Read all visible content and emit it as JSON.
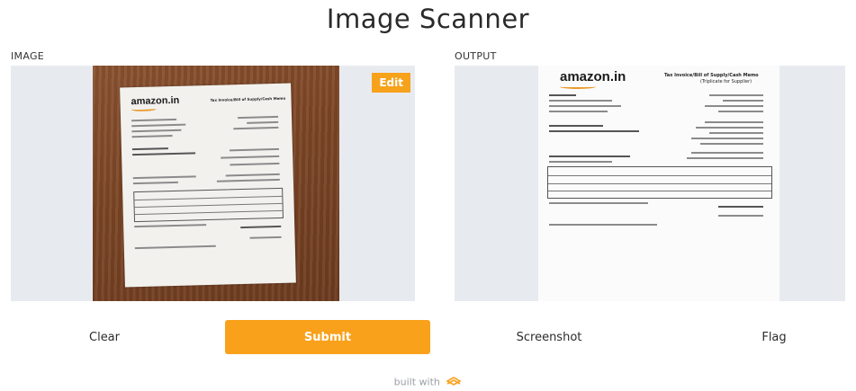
{
  "app": {
    "title": "Image Scanner"
  },
  "input": {
    "label": "IMAGE",
    "edit_label": "Edit"
  },
  "output": {
    "label": "OUTPUT"
  },
  "document": {
    "logo": "amazon.in",
    "header_line": "Tax Invoice/Bill of Supply/Cash Memo",
    "subheader": "(Triplicate for Supplier)"
  },
  "actions": {
    "clear": "Clear",
    "submit": "Submit",
    "screenshot": "Screenshot",
    "flag": "Flag"
  },
  "footer": {
    "text": "built with"
  },
  "colors": {
    "accent": "#f9a11b",
    "panel": "#e7ebf0",
    "wood": "#7a4424"
  }
}
